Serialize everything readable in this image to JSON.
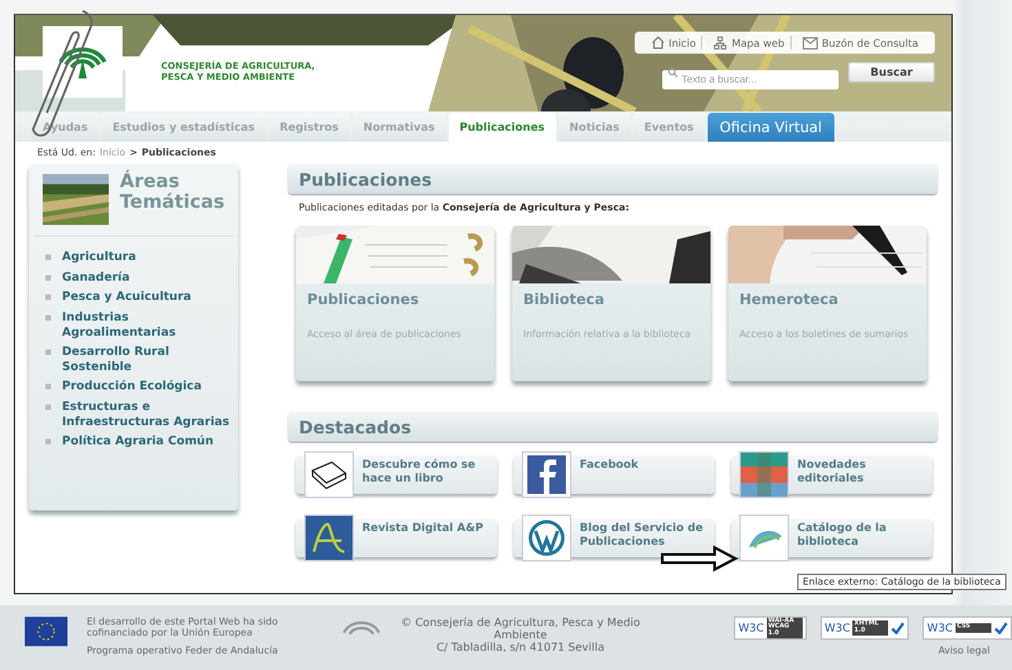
{
  "header": {
    "department": "CONSEJERÍA DE AGRICULTURA, PESCA Y MEDIO AMBIENTE",
    "top_links": [
      {
        "label": "Inicio",
        "kind": "home"
      },
      {
        "label": "Mapa web",
        "kind": "sitemap"
      },
      {
        "label": "Buzón de Consulta",
        "kind": "mail"
      }
    ],
    "search": {
      "placeholder": "Texto a buscar...",
      "button": "Buscar"
    }
  },
  "nav": {
    "tabs": [
      {
        "label": "Ayudas",
        "selected": false,
        "kind": "tab"
      },
      {
        "label": "Estudios y estadísticas",
        "selected": false,
        "kind": "tab"
      },
      {
        "label": "Registros",
        "selected": false,
        "kind": "tab"
      },
      {
        "label": "Normativas",
        "selected": false,
        "kind": "tab"
      },
      {
        "label": "Publicaciones",
        "selected": true,
        "kind": "tab"
      },
      {
        "label": "Noticias",
        "selected": false,
        "kind": "tab"
      },
      {
        "label": "Eventos",
        "selected": false,
        "kind": "tab"
      },
      {
        "label": "Oficina Virtual",
        "selected": false,
        "kind": "virtual"
      }
    ]
  },
  "breadcrumb": {
    "label": "Está Ud. en:",
    "separator": ">",
    "items": [
      {
        "label": "Inicio",
        "kind": "link"
      },
      {
        "label": "Publicaciones",
        "kind": "current"
      }
    ]
  },
  "sidebar": {
    "title": "Áreas Temáticas",
    "items": [
      "Agricultura",
      "Ganadería",
      "Pesca y Acuicultura",
      "Industrias Agroalimentarias",
      "Desarrollo Rural Sostenible",
      "Producción Ecológica",
      "Estructuras e Infraestructuras Agrarias",
      "Política Agraria Común"
    ]
  },
  "main": {
    "title": "Publicaciones",
    "intro": "Publicaciones editadas por la **Consejería de Agricultura y Pesca:**",
    "cards": [
      {
        "title": "Publicaciones",
        "description": "Acceso al área de publicaciones",
        "kind": "binder"
      },
      {
        "title": "Biblioteca",
        "description": "Información relativa a la biblioteca",
        "kind": "book"
      },
      {
        "title": "Hemeroteca",
        "description": "Acceso a los boletines de sumarios",
        "kind": "pen"
      }
    ]
  },
  "featured": {
    "title": "Destacados",
    "items": [
      {
        "label": "Descubre cómo se hace un libro",
        "kind": "book"
      },
      {
        "label": "Facebook",
        "kind": "facebook"
      },
      {
        "label": "Novedades editoriales",
        "kind": "mosaic"
      },
      {
        "label": "Revista Digital A&P",
        "kind": "magazine"
      },
      {
        "label": "Blog del Servicio de Publicaciones",
        "kind": "wordpress"
      },
      {
        "label": "Catálogo de la biblioteca",
        "kind": "catalog"
      }
    ]
  },
  "tooltip": "Enlace externo: Catálogo de la biblioteca",
  "footer": {
    "eu_note": "El desarrollo de este Portal Web ha sido cofinanciado por la Unión Europea",
    "program": "Programa operativo Feder de Andalucía",
    "publisher": "© Consejería de Agricultura, Pesca y Medio Ambiente",
    "address": "C/ Tabladilla, s/n 41071 Sevilla",
    "badges": [
      {
        "logo": "W3C",
        "label": "WAI-AA WCAG 1.0",
        "checked": false
      },
      {
        "logo": "W3C",
        "label": "XHTML 1.0",
        "checked": true
      },
      {
        "logo": "W3C",
        "label": "CSS",
        "checked": true
      }
    ],
    "legal": "Aviso legal"
  }
}
